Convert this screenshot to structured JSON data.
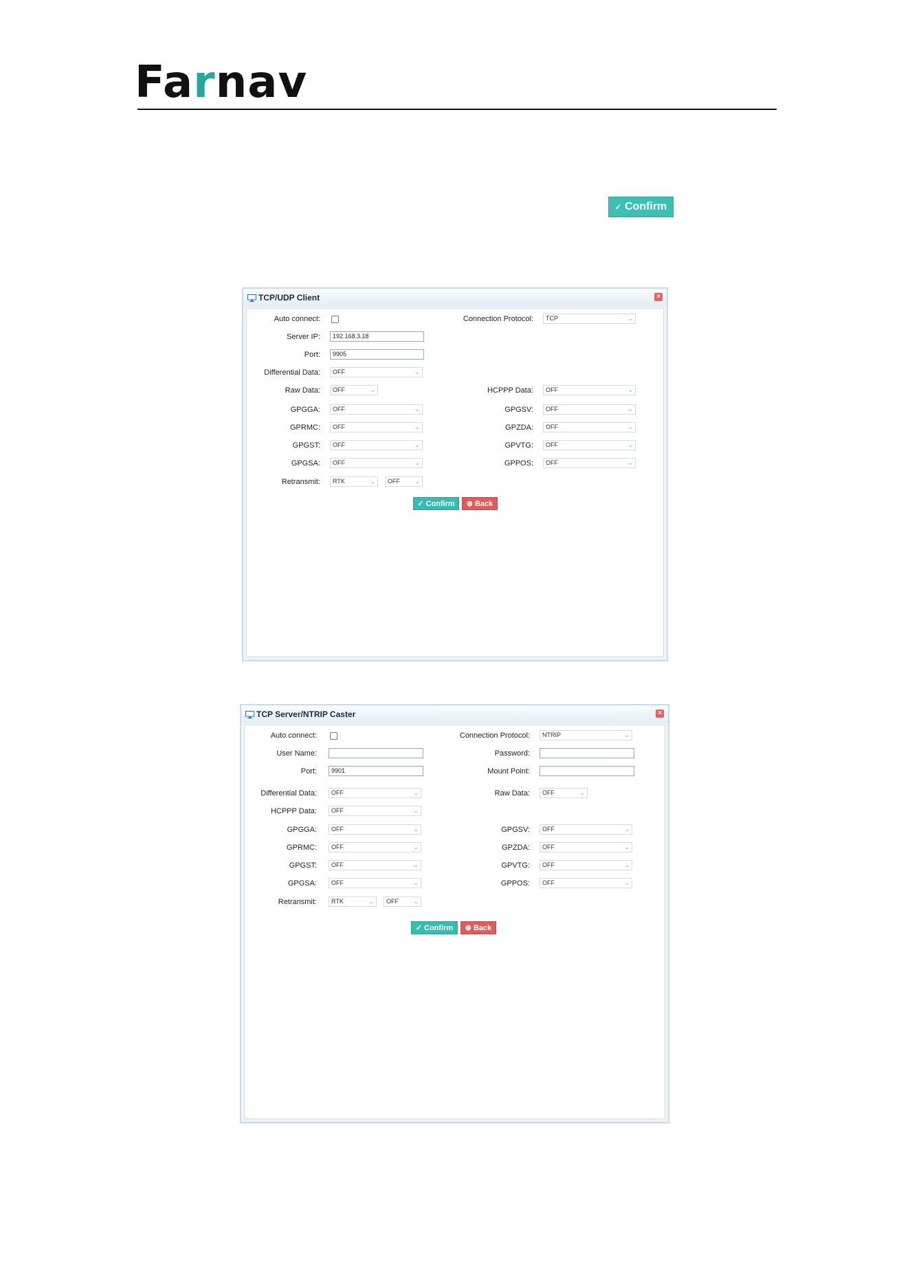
{
  "header": {
    "logo_prefix": "Fa",
    "logo_accent": "r",
    "logo_suffix": "nav"
  },
  "inline_button": {
    "icon": "check-circle-icon",
    "label": "Confirm"
  },
  "colors": {
    "accent": "#36bcb0",
    "danger": "#e05b5b",
    "brand_teal": "#27a7a0"
  },
  "client_dialog": {
    "title": "TCP/UDP Client",
    "close_icon": "close-icon",
    "auto_connect_label": "Auto connect:",
    "connection_protocol_label": "Connection Protocol:",
    "connection_protocol_value": "TCP",
    "server_ip_label": "Server IP:",
    "server_ip_value": "192.168.3.18",
    "port_label": "Port:",
    "port_value": "9905",
    "differential_label": "Differential Data:",
    "differential_value": "OFF",
    "raw_label": "Raw Data:",
    "raw_value": "OFF",
    "hcppp_label": "HCPPP Data:",
    "hcppp_value": "OFF",
    "gpgga_label": "GPGGA:",
    "gpgga_value": "OFF",
    "gprmc_label": "GPRMC:",
    "gprmc_value": "OFF",
    "gpgst_label": "GPGST:",
    "gpgst_value": "OFF",
    "gpgsa_label": "GPGSA:",
    "gpgsa_value": "OFF",
    "gpgsv_label": "GPGSV:",
    "gpgsv_value": "OFF",
    "gpzda_label": "GPZDA:",
    "gpzda_value": "OFF",
    "gpvtg_label": "GPVTG:",
    "gpvtg_value": "OFF",
    "gppos_label": "GPPOS:",
    "gppos_value": "OFF",
    "retransmit_label": "Retransmit:",
    "retransmit_value": "RTK",
    "retransmit_value2": "OFF",
    "confirm_label": "Confirm",
    "back_label": "Back"
  },
  "server_dialog": {
    "title": "TCP Server/NTRIP Caster",
    "close_icon": "close-icon",
    "auto_connect_label": "Auto connect:",
    "connection_protocol_label": "Connection Protocol:",
    "connection_protocol_value": "NTRIP",
    "username_label": "User Name:",
    "username_value": "",
    "password_label": "Password:",
    "password_value": "",
    "port_label": "Port:",
    "port_value": "9901",
    "mount_point_label": "Mount Point:",
    "mount_point_value": "",
    "differential_label": "Differential Data:",
    "differential_value": "OFF",
    "raw_label": "Raw Data:",
    "raw_value": "OFF",
    "hcppp_label": "HCPPP Data:",
    "hcppp_value": "OFF",
    "gpgga_label": "GPGGA:",
    "gpgga_value": "OFF",
    "gprmc_label": "GPRMC:",
    "gprmc_value": "OFF",
    "gpgst_label": "GPGST:",
    "gpgst_value": "OFF",
    "gpgsa_label": "GPGSA:",
    "gpgsa_value": "OFF",
    "gpgsv_label": "GPGSV:",
    "gpgsv_value": "OFF",
    "gpzda_label": "GPZDA:",
    "gpzda_value": "OFF",
    "gpvtg_label": "GPVTG:",
    "gpvtg_value": "OFF",
    "gppos_label": "GPPOS:",
    "gppos_value": "OFF",
    "retransmit_label": "Retransmit:",
    "retransmit_value": "RTK",
    "retransmit_value2": "OFF",
    "confirm_label": "Confirm",
    "back_label": "Back"
  }
}
